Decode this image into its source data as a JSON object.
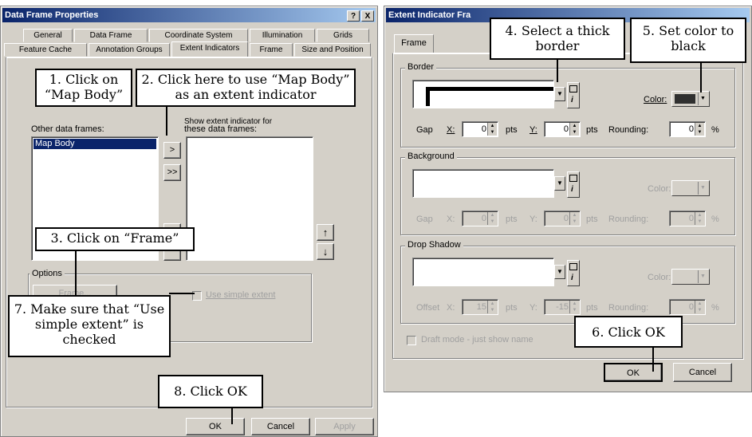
{
  "dialog1": {
    "title": "Data Frame Properties",
    "help_btn": "?",
    "close_btn": "X",
    "tabs_row1": [
      "General",
      "Data Frame",
      "Coordinate System",
      "Illumination",
      "Grids"
    ],
    "tabs_row2": [
      "Feature Cache",
      "Annotation Groups",
      "Extent Indicators",
      "Frame",
      "Size and Position"
    ],
    "active_tab": "Extent Indicators",
    "other_frames_label": "Other data frames:",
    "other_frames_items": [
      "Map Body"
    ],
    "show_label_line1": "Show extent indicator for",
    "show_label_line2": "these data frames:",
    "move_one_btn": ">",
    "move_all_btn": ">>",
    "move_up_icon": "up-arrow-icon",
    "move_down_icon": "down-arrow-icon",
    "options_label": "Options",
    "frame_btn": "Frame...",
    "simple_extent_label": "Use simple extent",
    "ok_btn": "OK",
    "cancel_btn": "Cancel",
    "apply_btn": "Apply"
  },
  "dialog2": {
    "title": "Extent Indicator Fra",
    "tab_frame": "Frame",
    "border_group": "Border",
    "background_group": "Background",
    "drop_shadow_group": "Drop Shadow",
    "color_label": "Color:",
    "gap_label": "Gap",
    "offset_label": "Offset",
    "x_label": "X:",
    "y_label": "Y:",
    "pts_label": "pts",
    "rounding_label": "Rounding:",
    "pct": "%",
    "border_gap_x": "0",
    "border_gap_y": "0",
    "border_rounding": "0",
    "bg_gap_x": "0",
    "bg_gap_y": "0",
    "bg_rounding": "0",
    "shadow_offset_x": "15",
    "shadow_offset_y": "-15",
    "shadow_rounding": "0",
    "border_color": "#303030",
    "draft_mode_label": "Draft mode - just show name",
    "ok_btn": "OK",
    "cancel_btn": "Cancel"
  },
  "callouts": {
    "c1": "1. Click on “Map Body”",
    "c2": "2. Click here to use “Map Body” as an extent indicator",
    "c3": "3. Click on “Frame”",
    "c4": "4. Select a thick border",
    "c5": "5. Set color to black",
    "c6": "6. Click OK",
    "c7": "7. Make sure that “Use simple extent” is checked",
    "c8": "8. Click OK"
  }
}
